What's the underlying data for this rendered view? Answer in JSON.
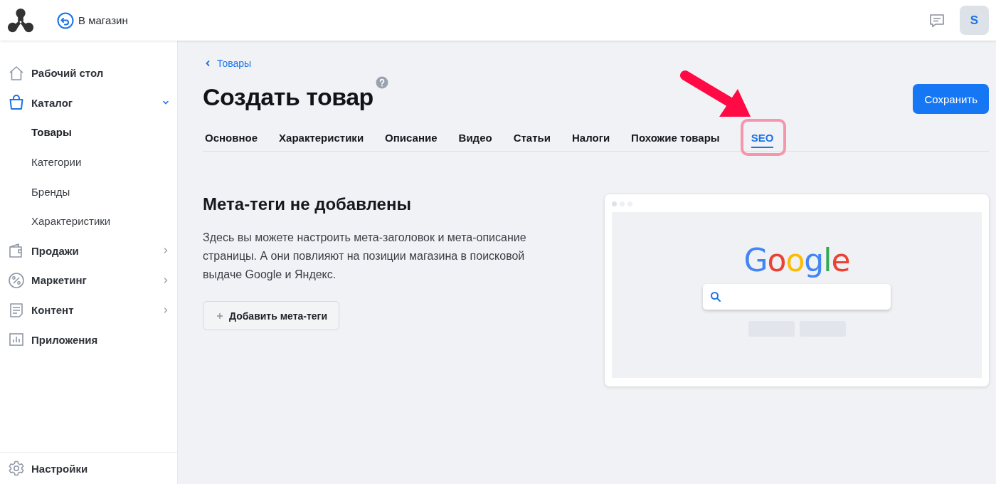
{
  "header": {
    "store_link": "В магазин",
    "avatar": "S"
  },
  "sidebar": {
    "items": [
      {
        "label": "Рабочий стол",
        "kind": "link",
        "selected": false
      },
      {
        "label": "Каталог",
        "kind": "group",
        "selected": true,
        "expanded": true,
        "children": [
          {
            "label": "Товары",
            "selected": true
          },
          {
            "label": "Категории",
            "selected": false
          },
          {
            "label": "Бренды",
            "selected": false
          },
          {
            "label": "Характеристики",
            "selected": false
          }
        ]
      },
      {
        "label": "Продажи",
        "kind": "group",
        "selected": false,
        "expanded": false
      },
      {
        "label": "Маркетинг",
        "kind": "group",
        "selected": false,
        "expanded": false
      },
      {
        "label": "Контент",
        "kind": "group",
        "selected": false,
        "expanded": false
      },
      {
        "label": "Приложения",
        "kind": "link",
        "selected": false
      }
    ],
    "footer": {
      "label": "Настройки"
    }
  },
  "breadcrumb": "Товары",
  "title": "Создать товар",
  "save_button": "Сохранить",
  "tabs": [
    {
      "label": "Основное",
      "selected": false,
      "highlighted": false
    },
    {
      "label": "Характеристики",
      "selected": false,
      "highlighted": false
    },
    {
      "label": "Описание",
      "selected": false,
      "highlighted": false
    },
    {
      "label": "Видео",
      "selected": false,
      "highlighted": false
    },
    {
      "label": "Статьи",
      "selected": false,
      "highlighted": false
    },
    {
      "label": "Налоги",
      "selected": false,
      "highlighted": false
    },
    {
      "label": "Похожие товары",
      "selected": false,
      "highlighted": false
    },
    {
      "label": "SEO",
      "selected": true,
      "highlighted": true
    }
  ],
  "empty_state": {
    "heading": "Мета-теги не добавлены",
    "text": "Здесь вы можете настроить мета-заголовок и мета-описание страницы. А они повлияют на позиции магазина в поисковой выдаче Google и Яндекс.",
    "button": "Добавить мета-теги"
  },
  "illustration": {
    "logo": "Google"
  }
}
